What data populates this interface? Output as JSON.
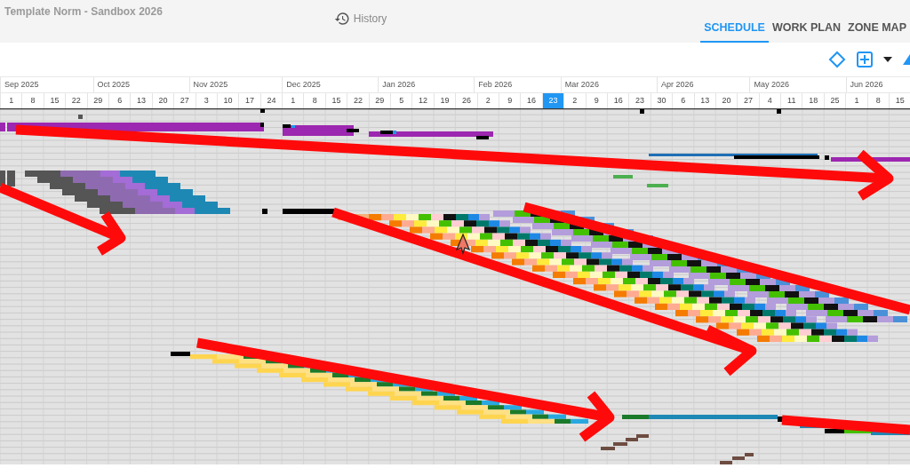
{
  "header": {
    "title": "Template Norm - Sandbox 2026",
    "history": "History"
  },
  "tabs": [
    {
      "label": "SCHEDULE",
      "selected": true
    },
    {
      "label": "WORK PLAN",
      "selected": false
    },
    {
      "label": "ZONE MAP",
      "selected": false
    }
  ],
  "timeline": {
    "months": [
      "Sep 2025",
      "Oct 2025",
      "Nov 2025",
      "Dec 2025",
      "Jan 2026",
      "Feb 2026",
      "Mar 2026",
      "Apr 2026",
      "May 2026",
      "Jun 2026"
    ],
    "weeks": [
      {
        "label": "1",
        "selected": false
      },
      {
        "label": "8",
        "selected": false
      },
      {
        "label": "15",
        "selected": false
      },
      {
        "label": "22",
        "selected": false
      },
      {
        "label": "29",
        "selected": false
      },
      {
        "label": "6",
        "selected": false
      },
      {
        "label": "13",
        "selected": false
      },
      {
        "label": "20",
        "selected": false
      },
      {
        "label": "27",
        "selected": false
      },
      {
        "label": "3",
        "selected": false
      },
      {
        "label": "10",
        "selected": false
      },
      {
        "label": "17",
        "selected": false
      },
      {
        "label": "24",
        "selected": false
      },
      {
        "label": "1",
        "selected": false
      },
      {
        "label": "8",
        "selected": false
      },
      {
        "label": "15",
        "selected": false
      },
      {
        "label": "22",
        "selected": false
      },
      {
        "label": "29",
        "selected": false
      },
      {
        "label": "5",
        "selected": false
      },
      {
        "label": "12",
        "selected": false
      },
      {
        "label": "19",
        "selected": false
      },
      {
        "label": "26",
        "selected": false
      },
      {
        "label": "2",
        "selected": false
      },
      {
        "label": "9",
        "selected": false
      },
      {
        "label": "16",
        "selected": false
      },
      {
        "label": "23",
        "selected": true
      },
      {
        "label": "2",
        "selected": false
      },
      {
        "label": "9",
        "selected": false
      },
      {
        "label": "16",
        "selected": false
      },
      {
        "label": "23",
        "selected": false
      },
      {
        "label": "30",
        "selected": false
      },
      {
        "label": "6",
        "selected": false
      },
      {
        "label": "13",
        "selected": false
      },
      {
        "label": "20",
        "selected": false
      },
      {
        "label": "27",
        "selected": false
      },
      {
        "label": "4",
        "selected": false
      },
      {
        "label": "11",
        "selected": false
      },
      {
        "label": "18",
        "selected": false
      },
      {
        "label": "25",
        "selected": false
      },
      {
        "label": "1",
        "selected": false
      },
      {
        "label": "8",
        "selected": false
      },
      {
        "label": "15",
        "selected": false
      }
    ]
  }
}
